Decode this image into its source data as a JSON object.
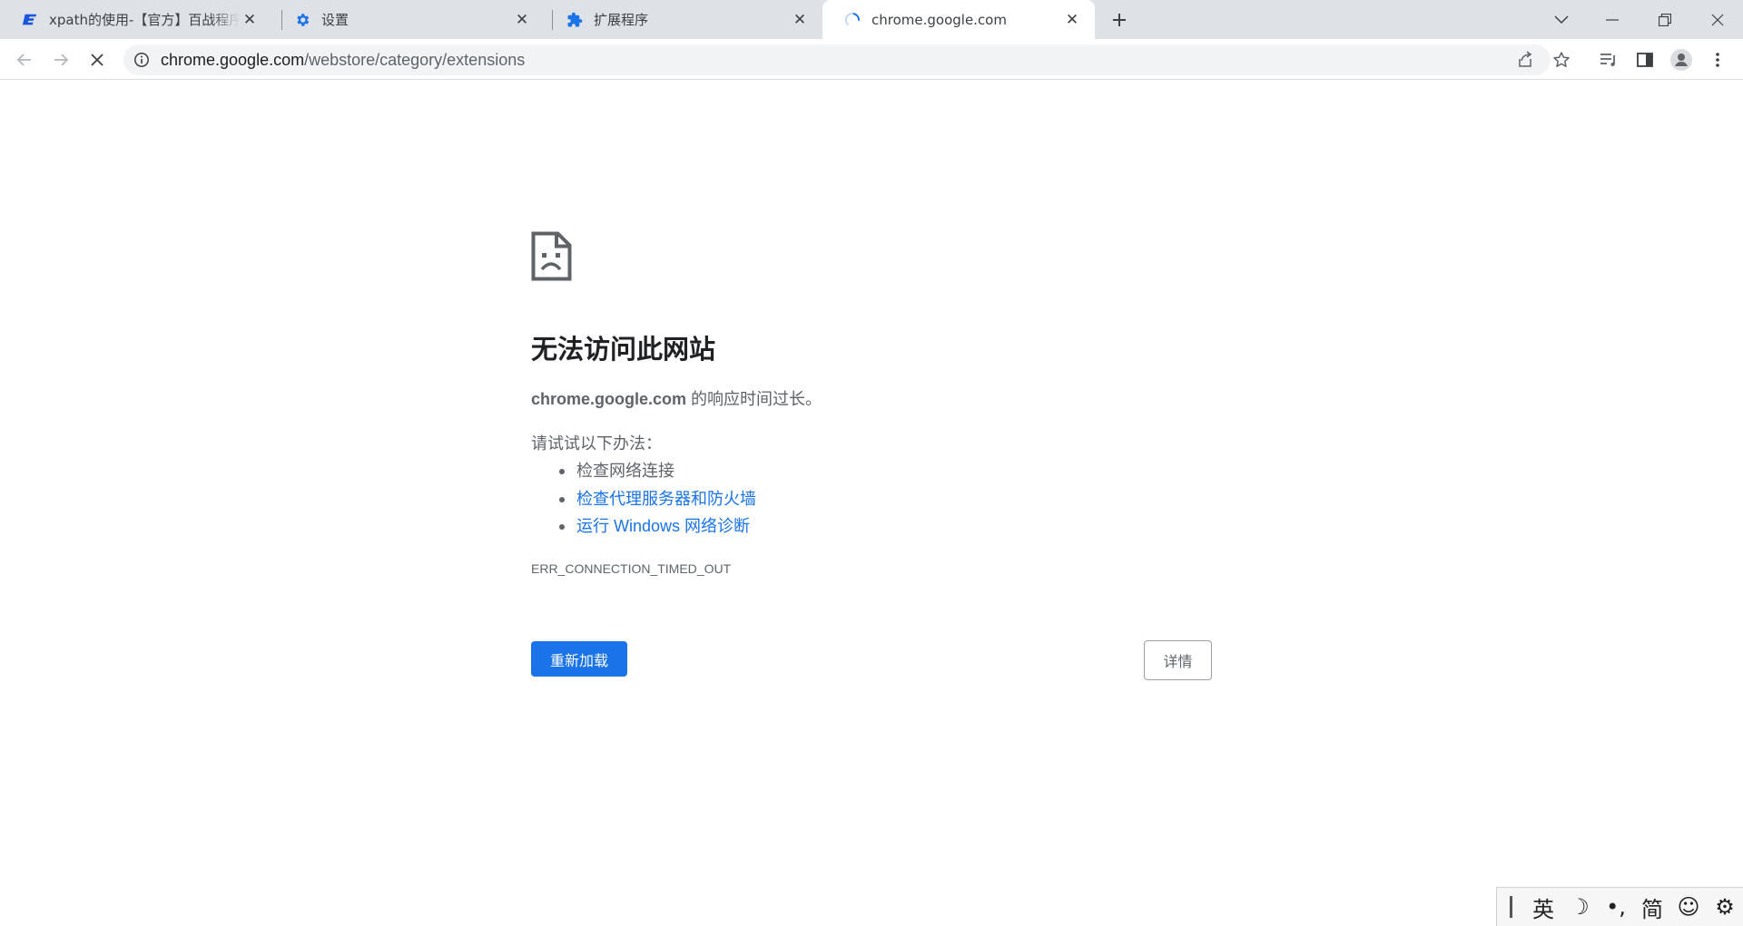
{
  "tabs": [
    {
      "title": "xpath的使用-【官方】百战程序员",
      "favicon": "baizhan-logo-icon"
    },
    {
      "title": "设置",
      "favicon": "settings-gear-icon"
    },
    {
      "title": "扩展程序",
      "favicon": "extension-puzzle-icon"
    },
    {
      "title": "chrome.google.com",
      "favicon": "loading-spinner-icon"
    }
  ],
  "omnibox": {
    "host": "chrome.google.com",
    "path": "/webstore/category/extensions"
  },
  "error": {
    "title": "无法访问此网站",
    "host": "chrome.google.com",
    "message": " 的响应时间过长。",
    "suggest_heading": "请试试以下办法：",
    "suggestions": [
      "检查网络连接",
      "检查代理服务器和防火墙",
      "运行 Windows 网络诊断"
    ],
    "code": "ERR_CONNECTION_TIMED_OUT",
    "reload_label": "重新加载",
    "details_label": "详情"
  },
  "ime": {
    "mode": "英",
    "moon": "☽",
    "punct": "•,",
    "script": "简",
    "emoji": "☺",
    "settings": "⚙"
  },
  "colors": {
    "accent": "#1a73e8",
    "tabstrip": "#dee1e6",
    "text_secondary": "#5f6368"
  }
}
